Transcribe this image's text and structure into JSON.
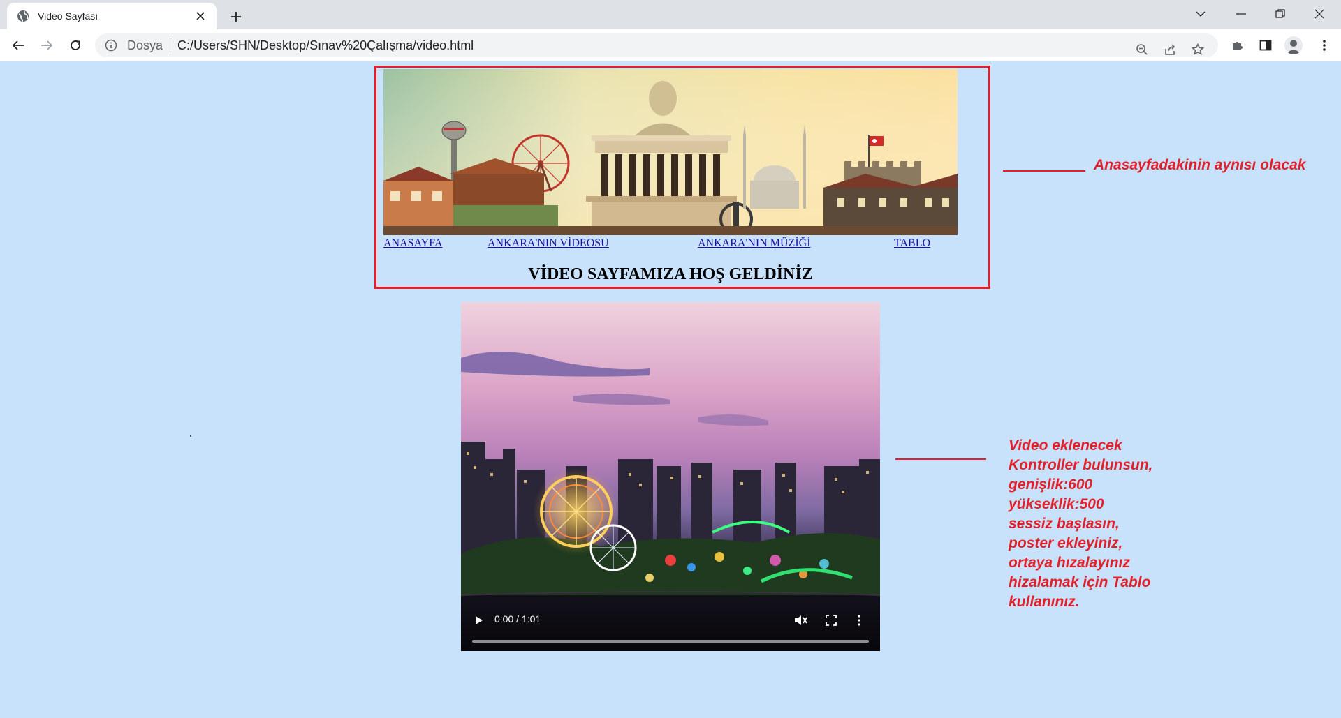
{
  "browser": {
    "tab_title": "Video Sayfası",
    "scheme_label": "Dosya",
    "url": "C:/Users/SHN/Desktop/Sınav%20Çalışma/video.html"
  },
  "icons": {
    "favicon": "globe-icon",
    "tab_close": "close-icon",
    "new_tab": "plus-icon",
    "back": "back-arrow-icon",
    "forward": "forward-arrow-icon",
    "reload": "reload-icon",
    "site_info": "info-icon",
    "zoom": "zoom-out-icon",
    "share": "share-icon",
    "bookmark": "star-icon",
    "extensions": "puzzle-icon",
    "side_panel": "side-panel-icon",
    "profile": "profile-icon",
    "menu": "kebab-menu-icon"
  },
  "page": {
    "nav": [
      "ANASAYFA",
      "ANKARA'NIN VİDEOSU",
      "ANKARA'NIN MÜZİĞİ",
      "TABLO"
    ],
    "welcome": "VİDEO SAYFAMIZA HOŞ GELDİNİZ"
  },
  "video": {
    "time": "0:00 / 1:01",
    "muted": true
  },
  "annotations": {
    "header_note": "Anasayfadakinin aynısı olacak",
    "video_note": [
      "Video eklenecek",
      "Kontroller bulunsun,",
      "genişlik:600",
      "yükseklik:500",
      "sessiz başlasın,",
      "poster ekleyiniz,",
      "ortaya hızalayınız",
      "hizalamak için Tablo",
      "kullanınız."
    ]
  },
  "colors": {
    "page_bg": "#c9e2fb",
    "annotation_red": "#e3202a",
    "link": "#1a0dab"
  }
}
